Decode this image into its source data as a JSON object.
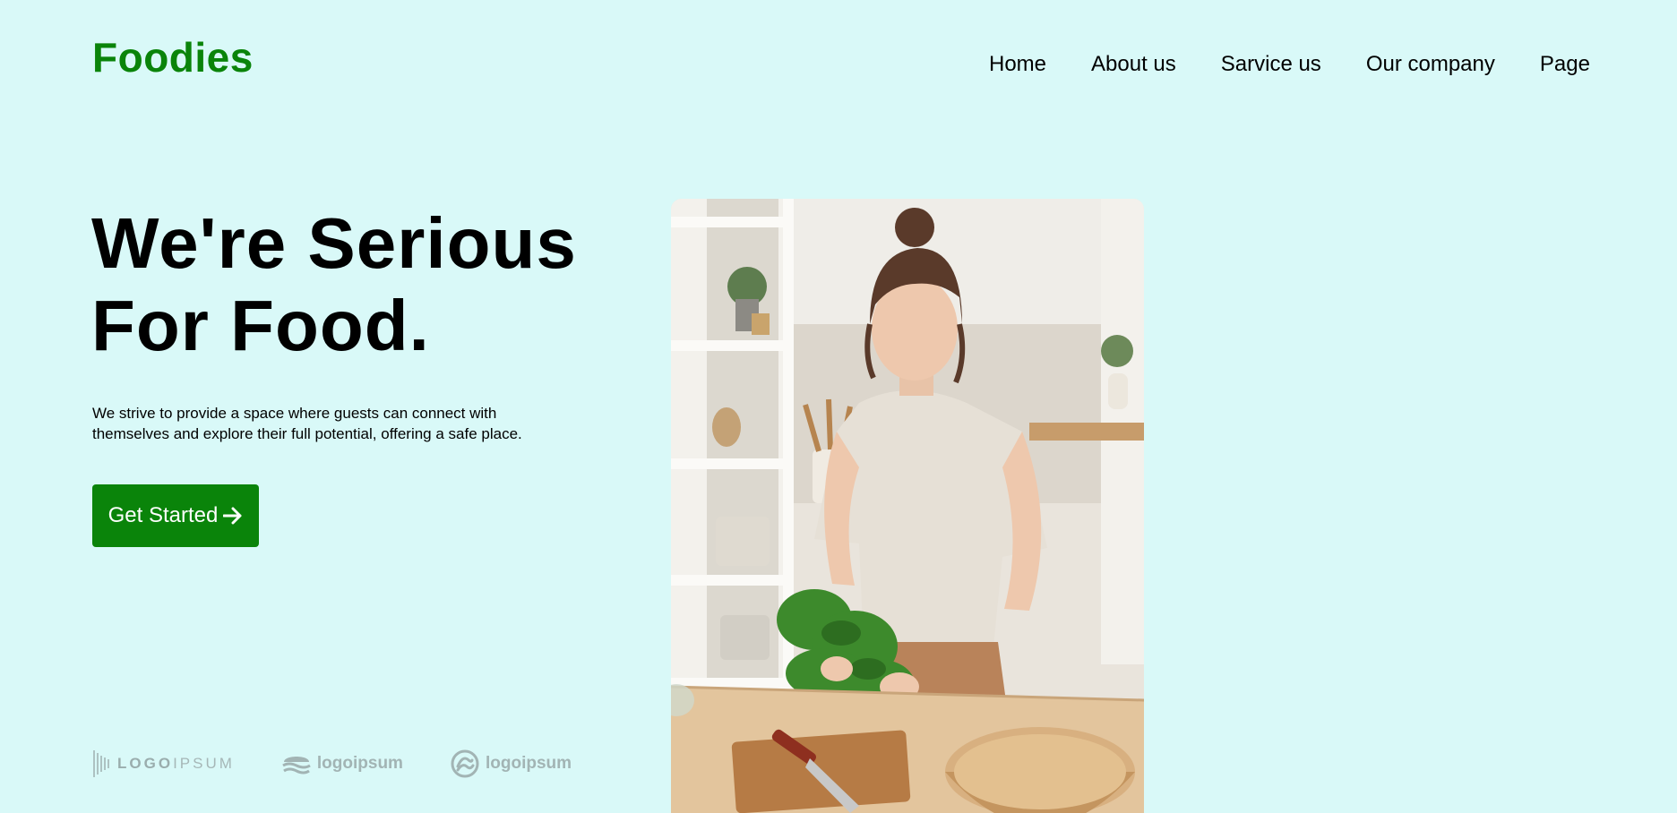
{
  "brand": {
    "name": "Foodies",
    "color": "#0a840a"
  },
  "nav": {
    "items": [
      {
        "label": "Home"
      },
      {
        "label": "About us"
      },
      {
        "label": "Sarvice us"
      },
      {
        "label": "Our company"
      },
      {
        "label": "Page"
      }
    ]
  },
  "hero": {
    "title_line1": "We're Serious",
    "title_line2": "For Food.",
    "description": "We strive to provide a space where guests can connect with themselves and explore their full potential, offering a safe place.",
    "cta_label": "Get Started",
    "cta_icon": "arrow-right-icon",
    "image_alt": "Woman holding lettuce in a kitchen"
  },
  "partners": [
    {
      "text_a": "LOGO",
      "text_b": "IPSUM",
      "icon": "barcode-icon"
    },
    {
      "text": "logoipsum",
      "icon": "wave-icon"
    },
    {
      "text": "logoipsum",
      "icon": "circle-swirl-icon"
    }
  ],
  "colors": {
    "background": "#d9f9f8",
    "accent": "#0a840a",
    "partner_logo": "#a2b4b4"
  }
}
